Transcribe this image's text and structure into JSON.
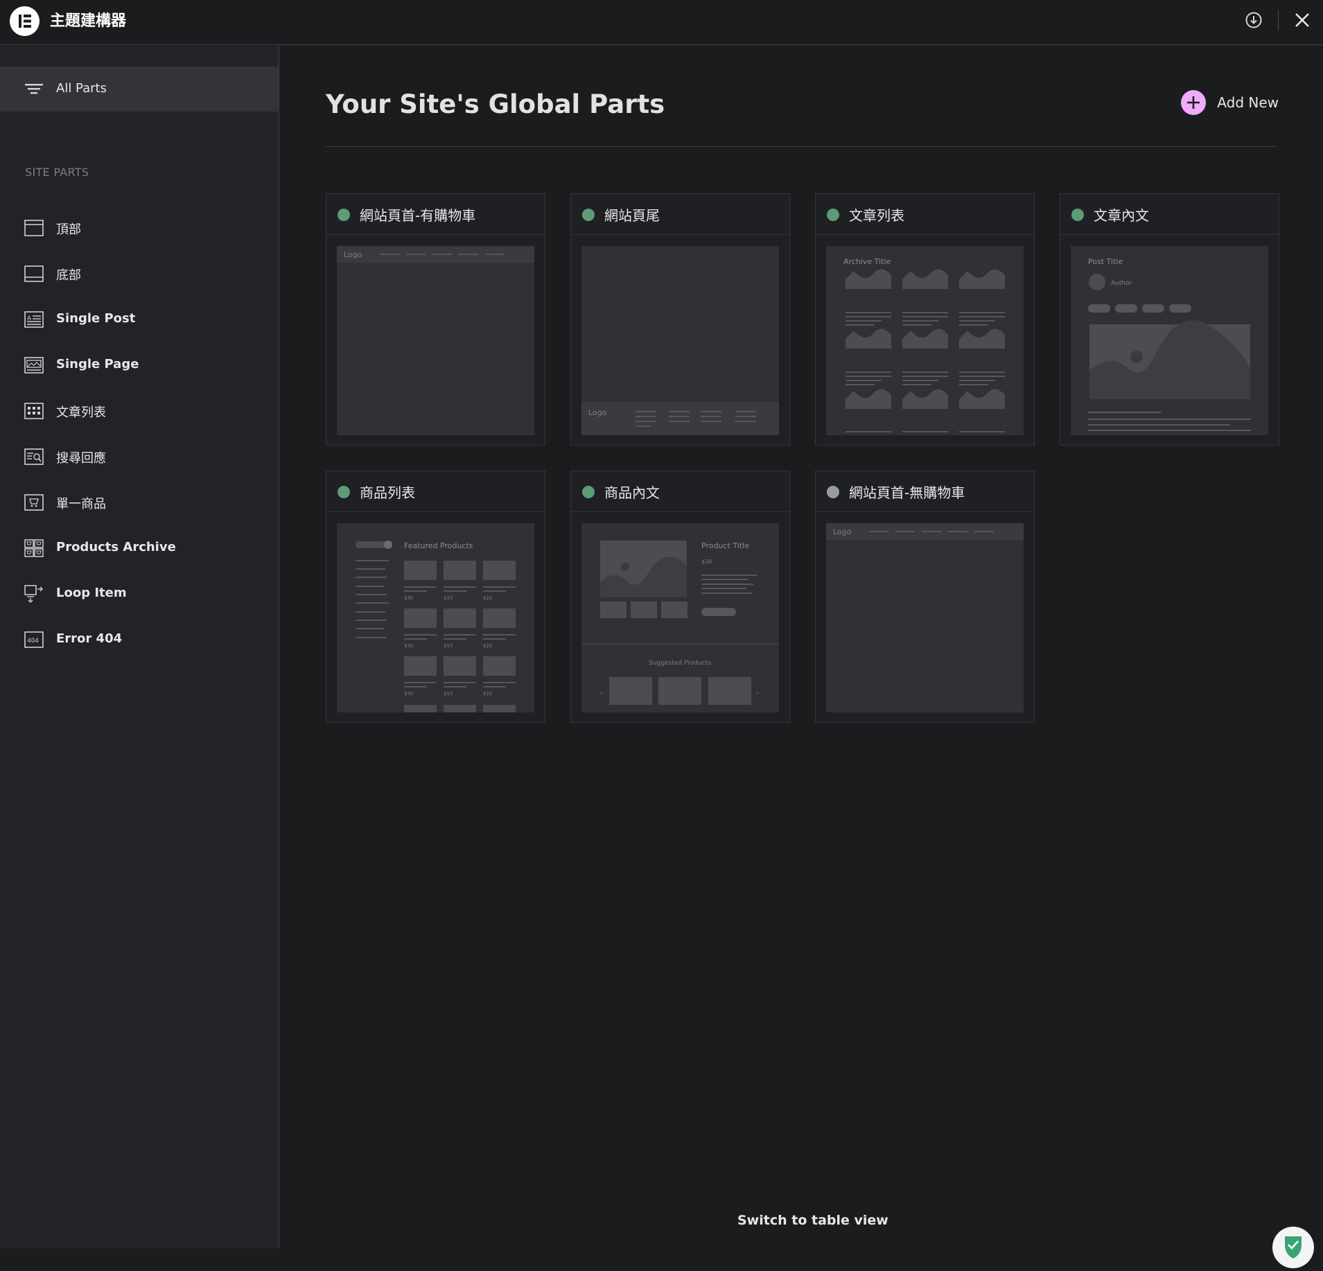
{
  "header": {
    "app_title": "主題建構器",
    "logo_icon": "elementor-logo-icon",
    "actions": [
      "download-icon",
      "close-icon"
    ]
  },
  "sidebar": {
    "all_parts_label": "All Parts",
    "section_title": "SITE PARTS",
    "items": [
      {
        "label": "頂部",
        "icon": "header-icon"
      },
      {
        "label": "底部",
        "icon": "footer-icon"
      },
      {
        "label": "Single Post",
        "icon": "single-post-icon"
      },
      {
        "label": "Single Page",
        "icon": "single-page-icon"
      },
      {
        "label": "文章列表",
        "icon": "archive-icon"
      },
      {
        "label": "搜尋回應",
        "icon": "search-results-icon"
      },
      {
        "label": "單一商品",
        "icon": "single-product-icon"
      },
      {
        "label": "Products Archive",
        "icon": "products-archive-icon"
      },
      {
        "label": "Loop Item",
        "icon": "loop-item-icon"
      },
      {
        "label": "Error 404",
        "icon": "error-404-icon"
      }
    ]
  },
  "main": {
    "title": "Your Site's Global Parts",
    "add_new_label": "Add New",
    "switch_view_label": "Switch to table view",
    "cards": [
      {
        "name": "網站頁首-有購物車",
        "status": "active",
        "thumb": "header",
        "thumb_text": "Logo"
      },
      {
        "name": "網站頁尾",
        "status": "active",
        "thumb": "footer",
        "thumb_text": "Logo"
      },
      {
        "name": "文章列表",
        "status": "active",
        "thumb": "archive",
        "thumb_text": "Archive Title"
      },
      {
        "name": "文章內文",
        "status": "active",
        "thumb": "single-post",
        "thumb_text": "Post Title",
        "thumb_sub": "Author"
      },
      {
        "name": "商品列表",
        "status": "active",
        "thumb": "products-archive",
        "thumb_text": "Featured Products",
        "prices": [
          "$30",
          "$15",
          "$22"
        ]
      },
      {
        "name": "商品內文",
        "status": "active",
        "thumb": "single-product",
        "thumb_text": "Product Title",
        "price": "$30",
        "suggested": "Suggested Products"
      },
      {
        "name": "網站頁首-無購物車",
        "status": "inactive",
        "thumb": "header",
        "thumb_text": "Logo"
      }
    ]
  },
  "colors": {
    "background": "#1b1c1e",
    "sidebar": "#222326",
    "active_dot": "#5e9c75",
    "inactive_dot": "#9a9ca3",
    "add_button": "#f0abfc"
  }
}
